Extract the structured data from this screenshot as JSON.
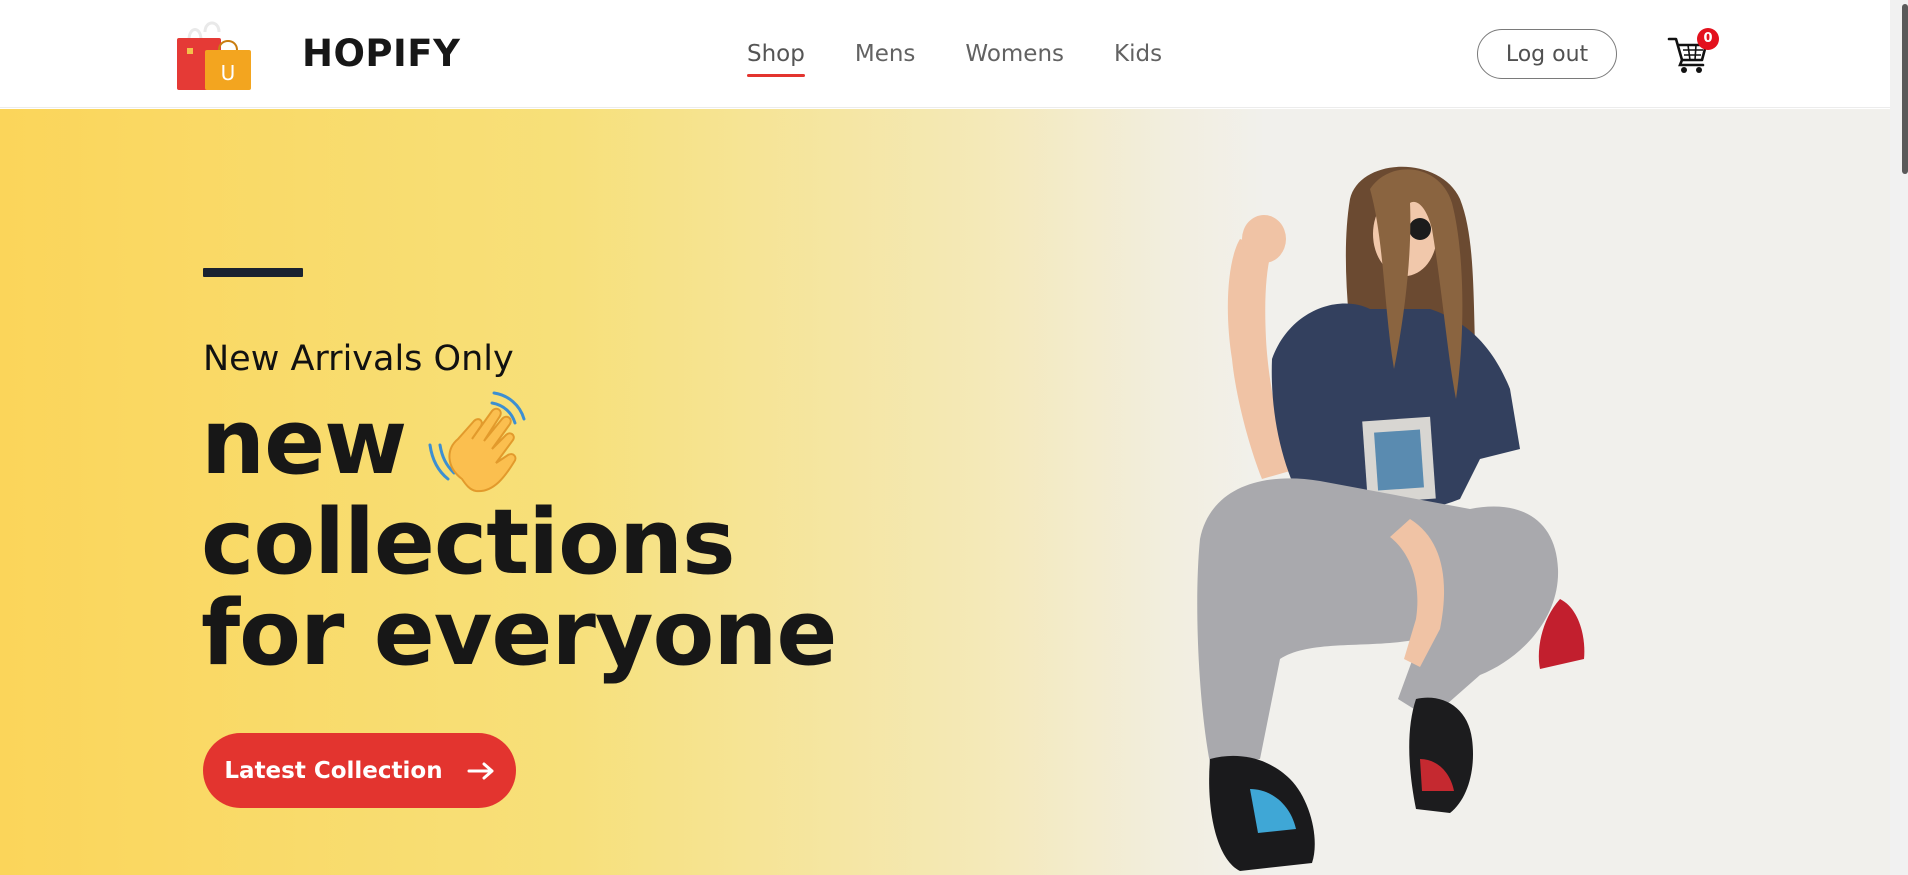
{
  "header": {
    "brand": "HOPIFY",
    "logo_icon": "shopping-bag-icon",
    "logo_letter": "U",
    "nav": [
      {
        "label": "Shop",
        "active": true
      },
      {
        "label": "Mens",
        "active": false
      },
      {
        "label": "Womens",
        "active": false
      },
      {
        "label": "Kids",
        "active": false
      }
    ],
    "logout_label": "Log out",
    "cart_icon": "cart-icon",
    "cart_count": "0"
  },
  "hero": {
    "subtitle": "New Arrivals Only",
    "headline_line1": "new",
    "headline_line2": "collections",
    "headline_line3": "for everyone",
    "wave_icon": "waving-hand-icon",
    "cta_label": "Latest Collection",
    "cta_icon": "arrow-right-icon",
    "hero_image": "model-photo"
  },
  "colors": {
    "accent": "#e3342f",
    "hero_gradient_start": "#fbd55a",
    "hero_background": "#f1f0ec",
    "text": "#171717"
  }
}
